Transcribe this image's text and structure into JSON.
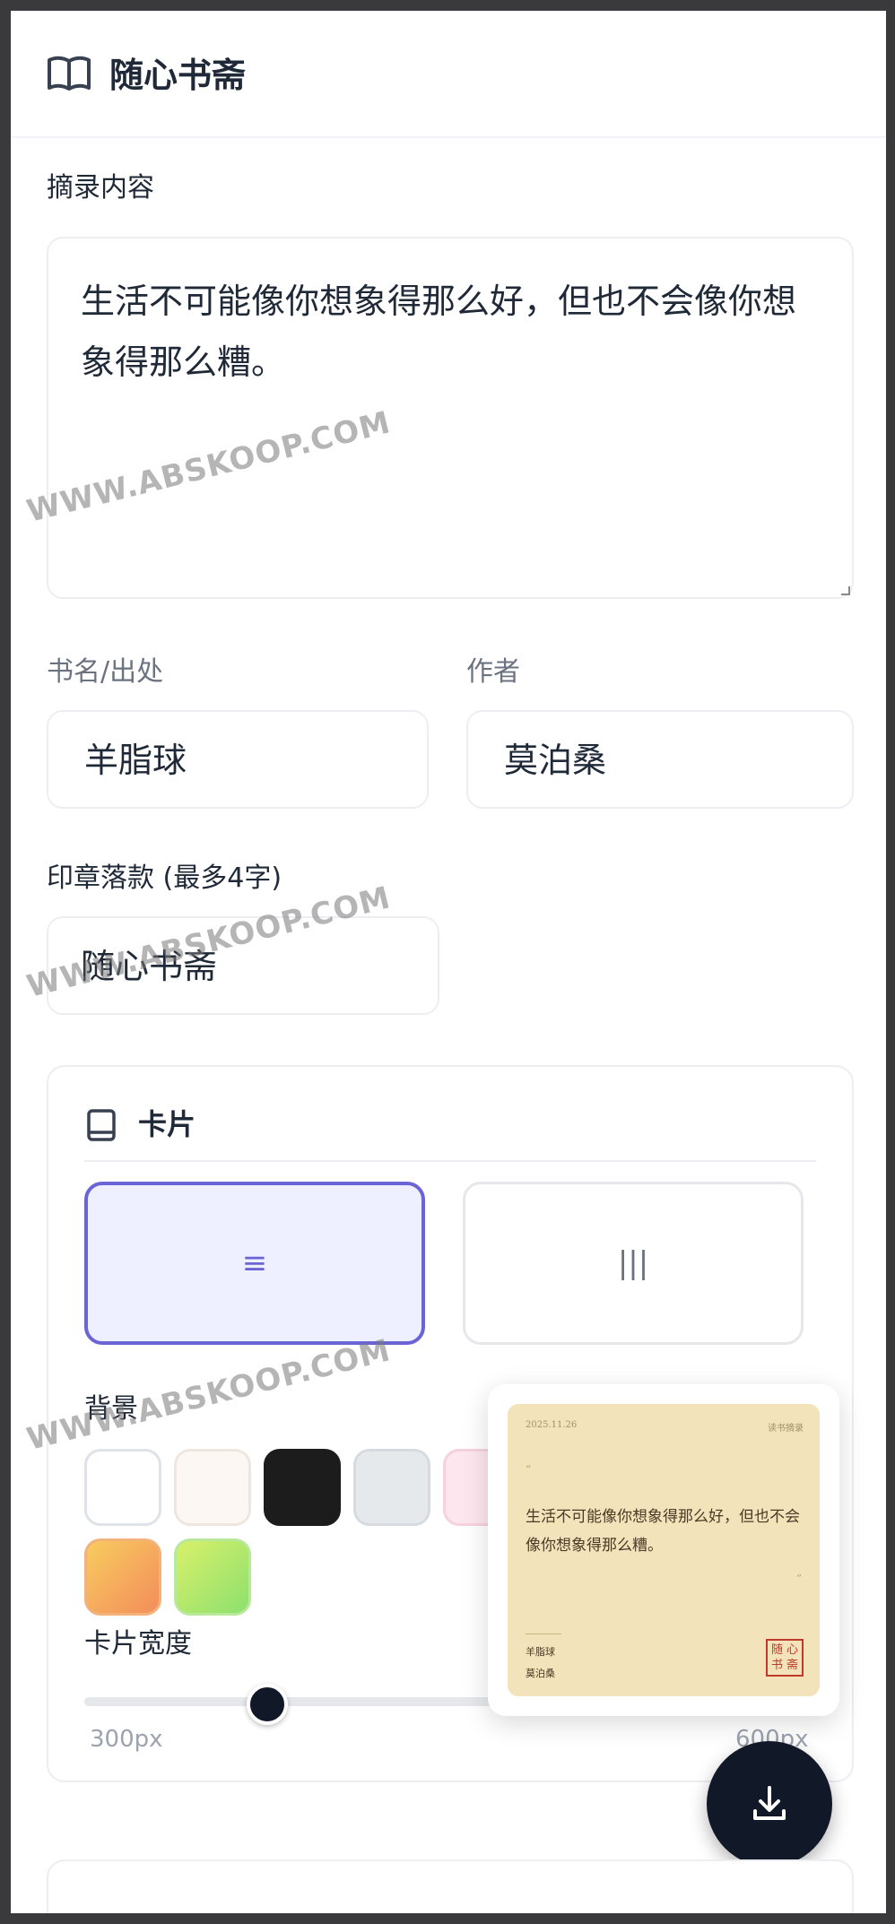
{
  "app": {
    "title": "随心书斋"
  },
  "excerpt": {
    "label": "摘录内容",
    "value": "生活不可能像你想象得那么好，但也不会像你想象得那么糟。"
  },
  "source": {
    "label": "书名/出处",
    "value": "羊脂球"
  },
  "author": {
    "label": "作者",
    "value": "莫泊桑"
  },
  "seal": {
    "label": "印章落款 (最多4字)",
    "value": "随心书斋"
  },
  "card_panel": {
    "title": "卡片",
    "layouts": [
      {
        "glyph": "≡",
        "selected": true
      },
      {
        "glyph": "|||",
        "selected": false
      }
    ],
    "background_label": "背景",
    "swatches": [
      "#ffffff",
      "#fcf7f2",
      "#1c1c1c",
      "#e5e9ec",
      "#fde6ee",
      "#f6a35a",
      "#b9ea6a"
    ],
    "width_label": "卡片宽度",
    "width_min": "300px",
    "width_max": "600px",
    "width_fraction": 0.25
  },
  "preview": {
    "date": "2025.11.26",
    "tag": "读书摘录",
    "open_quote": "“",
    "close_quote": "”",
    "quote": "生活不可能像你想象得那么好，但也不会像你想象得那么糟。",
    "book": "羊脂球",
    "author": "莫泊桑",
    "seal_chars": [
      "随",
      "心",
      "书",
      "斋"
    ],
    "bg": "#f3e3ba"
  },
  "watermark": "WWW.ABSKOOP.COM",
  "colors": {
    "accent": "#6b64d6",
    "dark": "#111827"
  }
}
